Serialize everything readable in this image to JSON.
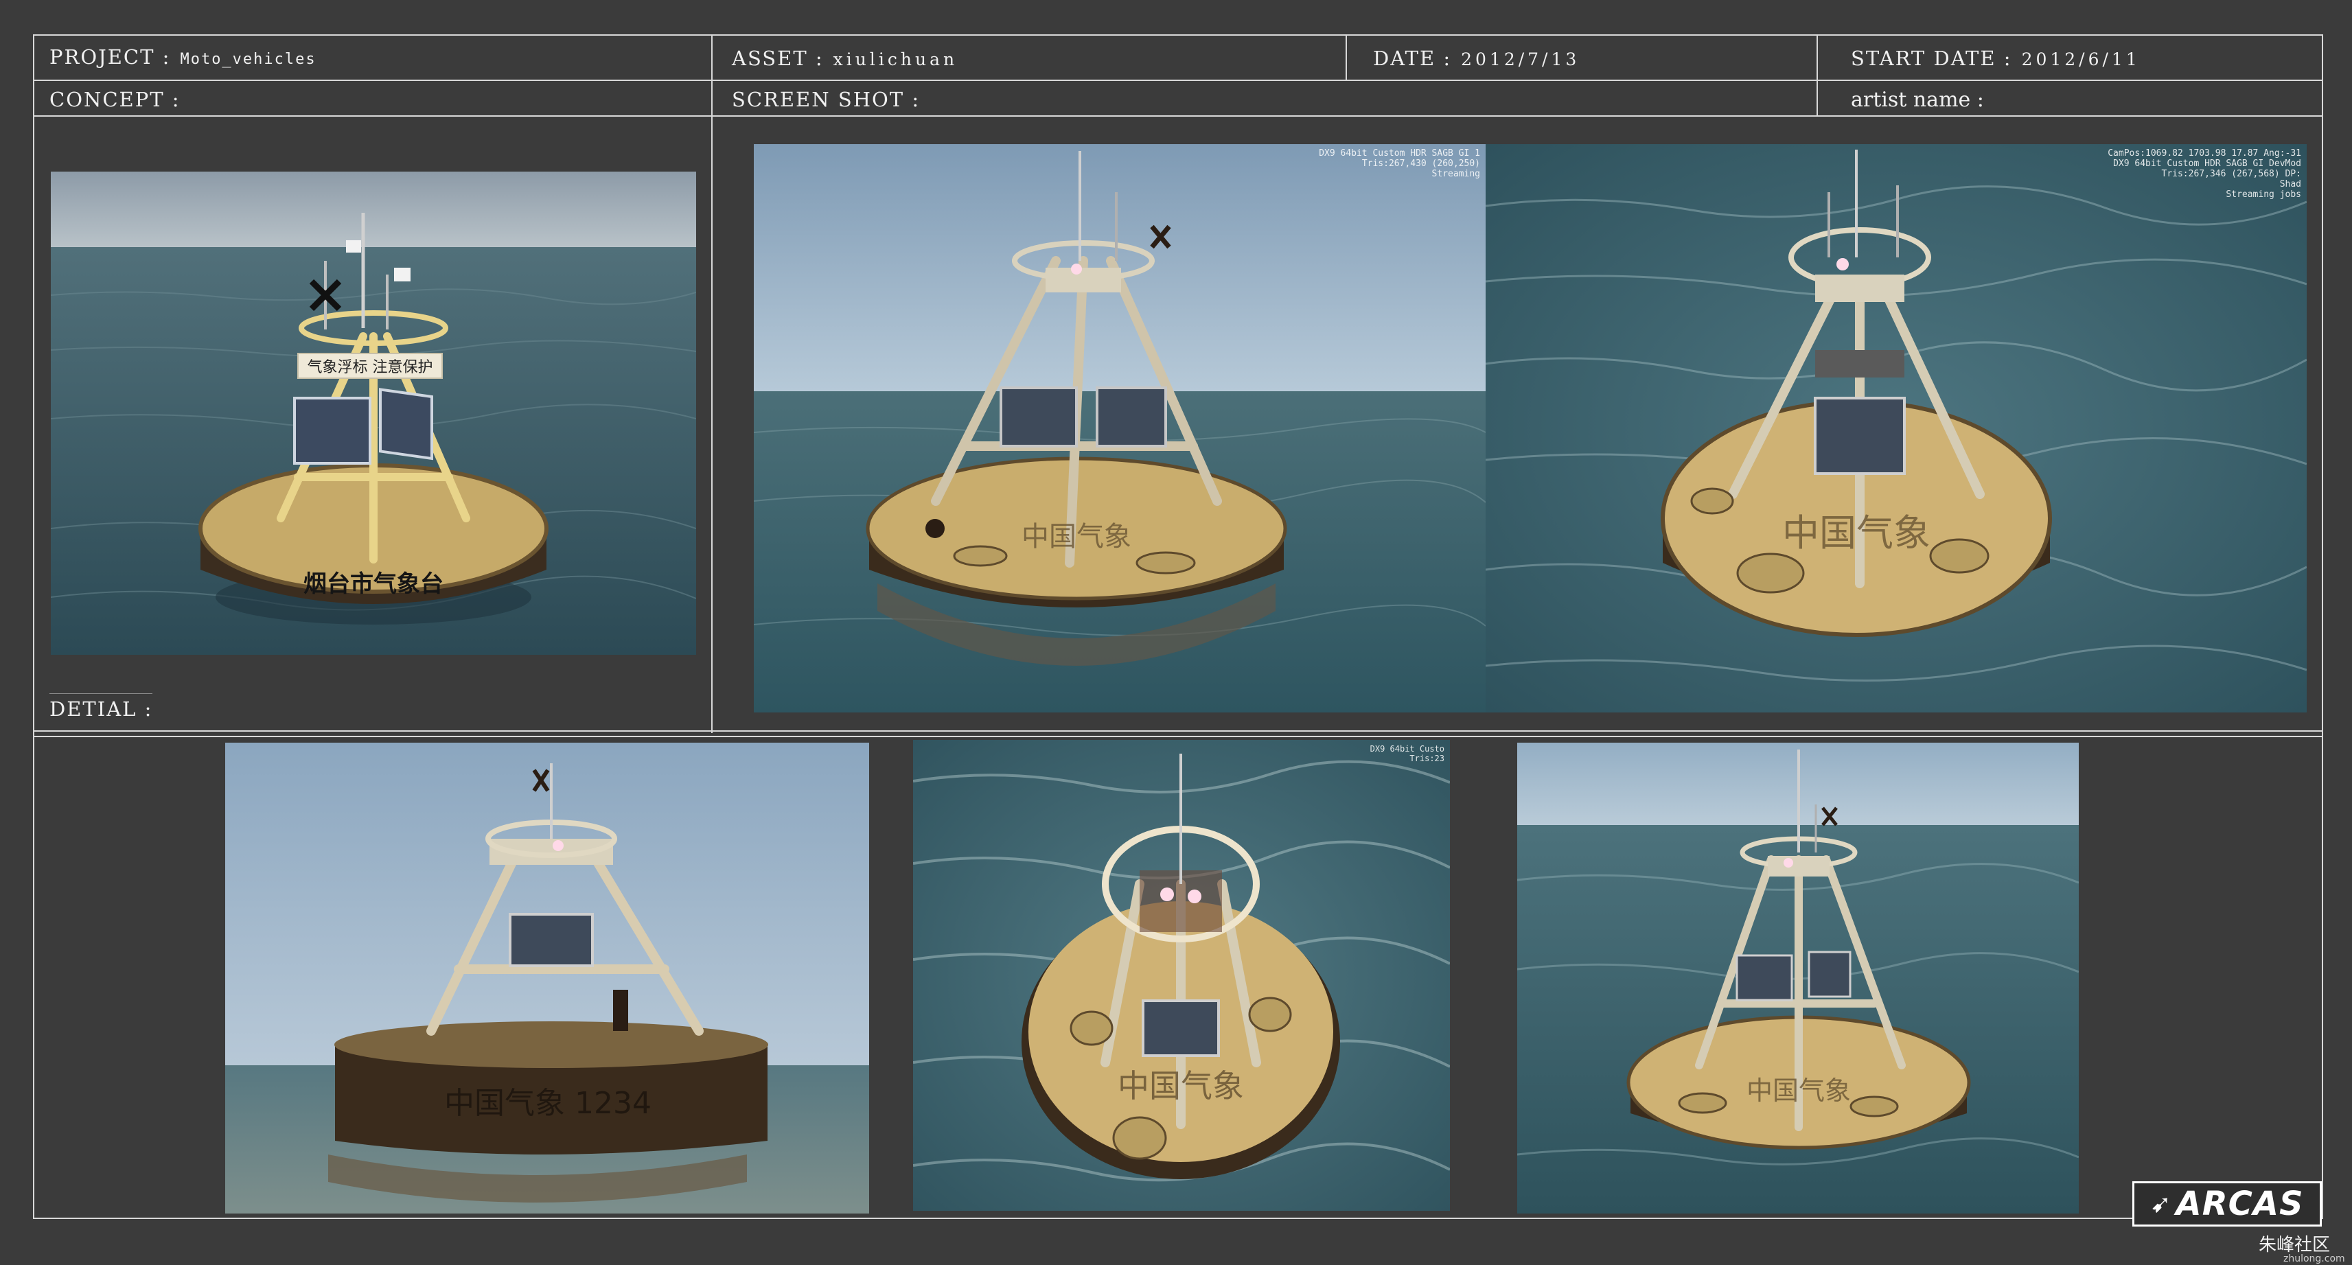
{
  "header": {
    "project_key": "PROJECT :",
    "project_value": "Moto_vehicles",
    "asset_key": "ASSET :",
    "asset_value": "xiulichuan",
    "date_key": "DATE :",
    "date_value": "2012/7/13",
    "start_date_key": "START DATE :",
    "start_date_value": "2012/6/11"
  },
  "subheader": {
    "concept": "CONCEPT :",
    "screenshot": "SCREEN SHOT :",
    "artist": "artist name :"
  },
  "detail_label": "DETIAL :",
  "concept_sign": "气象浮标 注意保护",
  "concept_hull_text": "烟台市气象台",
  "hud": {
    "shot1": "DX9 64bit Custom HDR SAGB GI 1\nTris:267,430 (260,250)\nStreaming",
    "shot2": "CamPos:1069.82 1703.98 17.87 Ang:-31\nDX9 64bit Custom HDR SAGB GI DevMod\nTris:267,346 (267,568) DP:\nShad\nStreaming jobs",
    "detail2": "DX9 64bit Custo\nTris:23"
  },
  "detail_hull_text": "中国气象 1234",
  "deck_text": "中国气象",
  "logo": "ARCAS",
  "watermark": "朱峰社区",
  "watermark_sub": "zhulong.com",
  "colors": {
    "background": "#3b3b3b",
    "frame": "#d8d8d8",
    "sea": "#3f6670",
    "sky": "#9fb7cc",
    "buoy_deck": "#c9ad6d",
    "buoy_hull": "#3a2e22"
  }
}
